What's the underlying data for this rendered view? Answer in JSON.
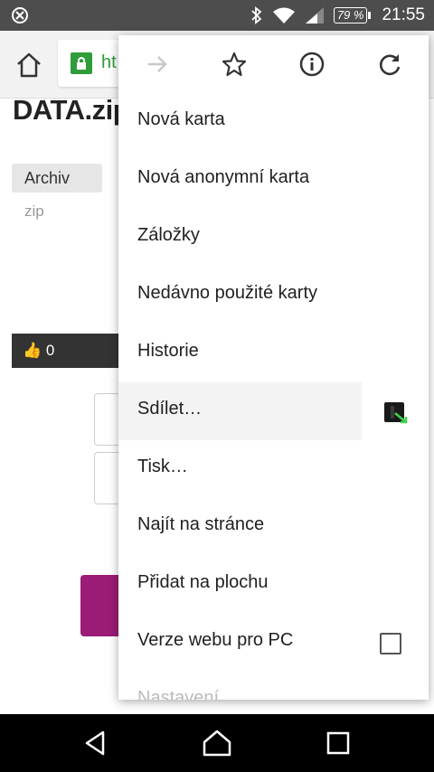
{
  "status_bar": {
    "battery": "79 %",
    "time": "21:55"
  },
  "toolbar": {
    "url_partial": "ht"
  },
  "page": {
    "title": "DATA.zip",
    "tag": "Archiv",
    "extension": "zip",
    "likes": "0"
  },
  "menu": {
    "items": [
      {
        "label": "Nová karta"
      },
      {
        "label": "Nová anonymní karta"
      },
      {
        "label": "Záložky"
      },
      {
        "label": "Nedávno použité karty"
      },
      {
        "label": "Historie"
      },
      {
        "label": "Sdílet…"
      },
      {
        "label": "Tisk…"
      },
      {
        "label": "Najít na stránce"
      },
      {
        "label": "Přidat na plochu"
      },
      {
        "label": "Verze webu pro PC"
      }
    ],
    "partial_item": "Nastavení"
  },
  "colors": {
    "status_bar": "#4d4d4d",
    "secure_green": "#2e9d3a",
    "brand_magenta": "#9b1b76"
  }
}
